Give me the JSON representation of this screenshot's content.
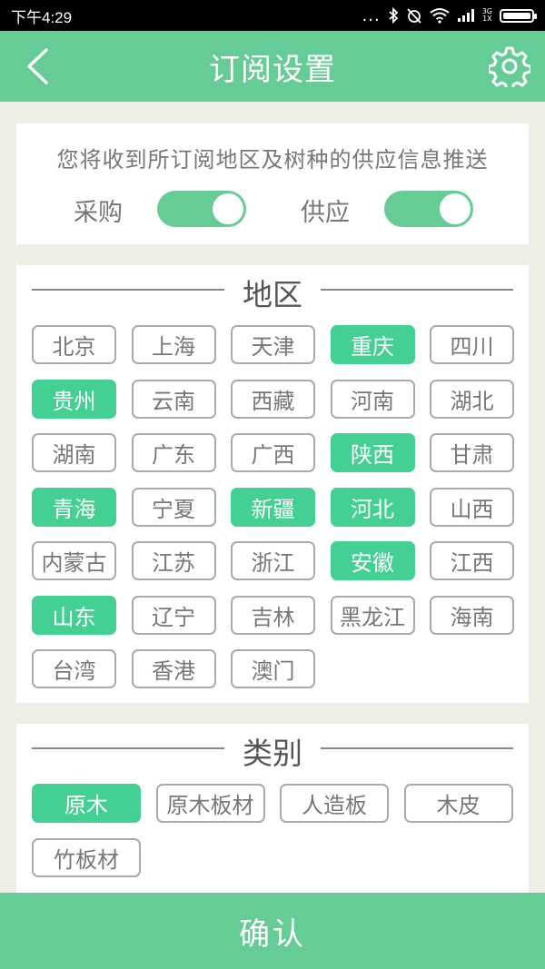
{
  "status_bar": {
    "time": "下午4:29",
    "signal_dots": "...",
    "net_top": "3G",
    "net_bottom": "1X"
  },
  "header": {
    "title": "订阅设置",
    "back_icon": "chevron-left-icon",
    "settings_icon": "gear-icon"
  },
  "subscription": {
    "description": "您将收到所订阅地区及树种的供应信息推送",
    "purchase_label": "采购",
    "purchase_on": true,
    "supply_label": "供应",
    "supply_on": true
  },
  "region": {
    "title": "地区",
    "items": [
      {
        "label": "北京",
        "selected": false
      },
      {
        "label": "上海",
        "selected": false
      },
      {
        "label": "天津",
        "selected": false
      },
      {
        "label": "重庆",
        "selected": true
      },
      {
        "label": "四川",
        "selected": false
      },
      {
        "label": "贵州",
        "selected": true
      },
      {
        "label": "云南",
        "selected": false
      },
      {
        "label": "西藏",
        "selected": false
      },
      {
        "label": "河南",
        "selected": false
      },
      {
        "label": "湖北",
        "selected": false
      },
      {
        "label": "湖南",
        "selected": false
      },
      {
        "label": "广东",
        "selected": false
      },
      {
        "label": "广西",
        "selected": false
      },
      {
        "label": "陕西",
        "selected": true
      },
      {
        "label": "甘肃",
        "selected": false
      },
      {
        "label": "青海",
        "selected": true
      },
      {
        "label": "宁夏",
        "selected": false
      },
      {
        "label": "新疆",
        "selected": true
      },
      {
        "label": "河北",
        "selected": true
      },
      {
        "label": "山西",
        "selected": false
      },
      {
        "label": "内蒙古",
        "selected": false
      },
      {
        "label": "江苏",
        "selected": false
      },
      {
        "label": "浙江",
        "selected": false
      },
      {
        "label": "安徽",
        "selected": true
      },
      {
        "label": "江西",
        "selected": false
      },
      {
        "label": "山东",
        "selected": true
      },
      {
        "label": "辽宁",
        "selected": false
      },
      {
        "label": "吉林",
        "selected": false
      },
      {
        "label": "黑龙江",
        "selected": false
      },
      {
        "label": "海南",
        "selected": false
      },
      {
        "label": "台湾",
        "selected": false
      },
      {
        "label": "香港",
        "selected": false
      },
      {
        "label": "澳门",
        "selected": false
      }
    ]
  },
  "category": {
    "title": "类别",
    "items": [
      {
        "label": "原木",
        "selected": true
      },
      {
        "label": "原木板材",
        "selected": false
      },
      {
        "label": "人造板",
        "selected": false
      },
      {
        "label": "木皮",
        "selected": false
      },
      {
        "label": "竹板材",
        "selected": false
      }
    ]
  },
  "confirm_label": "确认",
  "colors": {
    "brand": "#66cc95",
    "selected_chip": "#44cf93",
    "background": "#efeee6"
  }
}
